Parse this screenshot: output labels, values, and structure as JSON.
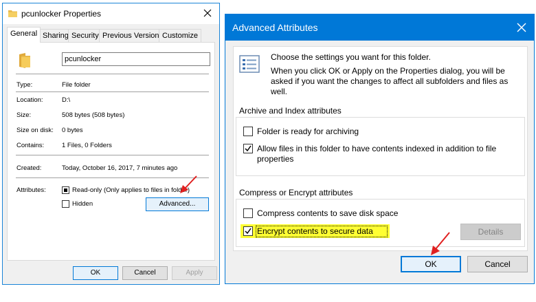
{
  "properties_window": {
    "title": "pcunlocker Properties",
    "tabs": [
      {
        "label": "General",
        "active": true
      },
      {
        "label": "Sharing",
        "active": false
      },
      {
        "label": "Security",
        "active": false
      },
      {
        "label": "Previous Versions",
        "active": false
      },
      {
        "label": "Customize",
        "active": false
      }
    ],
    "folder_name": "pcunlocker",
    "fields": {
      "type_label": "Type:",
      "type_value": "File folder",
      "location_label": "Location:",
      "location_value": "D:\\",
      "size_label": "Size:",
      "size_value": "508 bytes (508 bytes)",
      "size_on_disk_label": "Size on disk:",
      "size_on_disk_value": "0 bytes",
      "contains_label": "Contains:",
      "contains_value": "1 Files, 0 Folders",
      "created_label": "Created:",
      "created_value": "Today, October 16, 2017, 7 minutes ago",
      "attributes_label": "Attributes:"
    },
    "attributes": {
      "readonly_label": "Read-only (Only applies to files in folder)",
      "readonly_state": "indeterminate",
      "hidden_label": "Hidden",
      "hidden_checked": false,
      "advanced_button": "Advanced..."
    },
    "buttons": {
      "ok": "OK",
      "cancel": "Cancel",
      "apply": "Apply"
    }
  },
  "advanced_window": {
    "title": "Advanced Attributes",
    "intro_line1": "Choose the settings you want for this folder.",
    "intro_line2": "When you click OK or Apply on the Properties dialog, you will be asked if you want the changes to affect all subfolders and files as well.",
    "archive_group": {
      "title": "Archive and Index attributes",
      "archiving_label": "Folder is ready for archiving",
      "archiving_checked": false,
      "indexing_label_line1": "Allow files in this folder to have contents indexed in addition to file",
      "indexing_label_line2": "properties",
      "indexing_checked": true
    },
    "compress_group": {
      "title": "Compress or Encrypt attributes",
      "compress_label": "Compress contents to save disk space",
      "compress_checked": false,
      "encrypt_label": "Encrypt contents to secure data",
      "encrypt_checked": true,
      "details_button": "Details"
    },
    "buttons": {
      "ok": "OK",
      "cancel": "Cancel"
    },
    "colors": {
      "titlebar": "#0078d7",
      "highlight": "#ffff33",
      "arrow": "#e02020"
    }
  }
}
